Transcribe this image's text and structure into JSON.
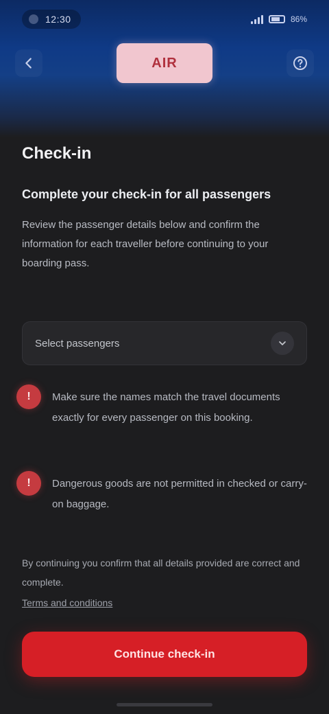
{
  "status_bar": {
    "time": "12:30",
    "battery": "86%"
  },
  "app_bar": {
    "back_icon": "arrow-left-icon",
    "logo_text": "AIR",
    "help_icon": "help-circle-icon"
  },
  "page": {
    "title": "Check-in",
    "headline": "Complete your check-in for all passengers",
    "description": "Review the passenger details below and confirm the information for each traveller before continuing to your boarding pass."
  },
  "selector": {
    "label": "Select passengers",
    "icon": "chevron-down-icon"
  },
  "info_items": [
    {
      "badge": "!",
      "text": "Make sure the names match the travel documents exactly for every passenger on this booking."
    },
    {
      "badge": "!",
      "text": "Dangerous goods are not permitted in checked or carry-on baggage."
    }
  ],
  "footnote": "By continuing you confirm that all details provided are correct and complete.",
  "terms_link": "Terms and conditions",
  "cta": {
    "label": "Continue check-in"
  },
  "colors": {
    "header_blue": "#0f3a86",
    "accent_red": "#d61f26",
    "logo_pink": "#f1c6cf",
    "background": "#1d1d1f"
  }
}
